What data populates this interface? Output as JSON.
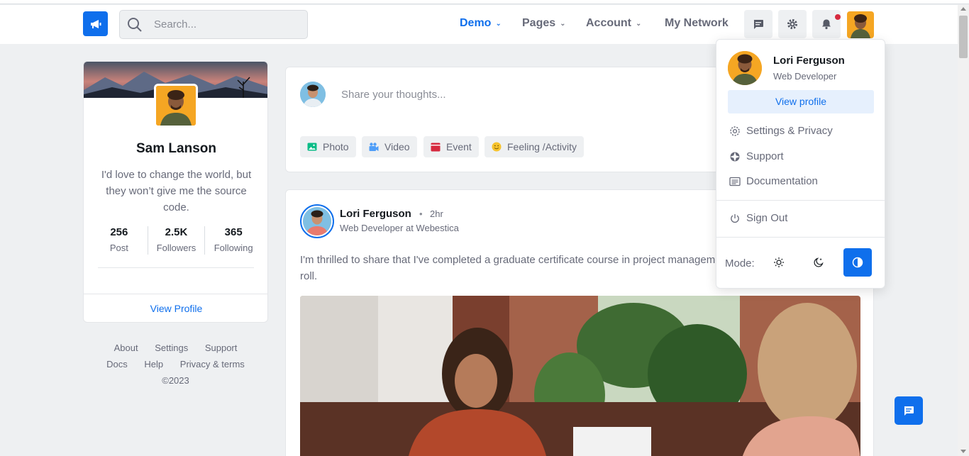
{
  "search": {
    "placeholder": "Search..."
  },
  "nav": {
    "links": [
      {
        "label": "Demo",
        "chevron": "⌄"
      },
      {
        "label": "Pages",
        "chevron": "⌄"
      },
      {
        "label": "Account",
        "chevron": "⌄"
      },
      {
        "label": "My Network"
      }
    ]
  },
  "profile": {
    "name": "Sam Lanson",
    "bio": "I'd love to change the world, but they won’t give me the source code.",
    "stats": [
      {
        "value": "256",
        "label": "Post"
      },
      {
        "value": "2.5K",
        "label": "Followers"
      },
      {
        "value": "365",
        "label": "Following"
      }
    ],
    "view_profile": "View Profile"
  },
  "side_links": {
    "row1": [
      "About",
      "Settings",
      "Support"
    ],
    "row2": [
      "Docs",
      "Help",
      "Privacy & terms"
    ],
    "copyright": "©2023"
  },
  "composer": {
    "placeholder": "Share your thoughts...",
    "actions": [
      {
        "label": "Photo",
        "icon": "image-icon",
        "color": "#0cbc87"
      },
      {
        "label": "Video",
        "icon": "video-icon",
        "color": "#4f9ef8"
      },
      {
        "label": "Event",
        "icon": "calendar-icon",
        "color": "#d6293e"
      },
      {
        "label": "Feeling /Activity",
        "icon": "smiley-icon",
        "color": "#f7c32e"
      }
    ]
  },
  "post": {
    "author": "Lori Ferguson",
    "dot": "•",
    "time": "2hr",
    "role": "Web Developer at Webestica",
    "text": "I'm thrilled to share that I've completed a graduate certificate course in project management with the president's honor roll."
  },
  "dropdown": {
    "name": "Lori Ferguson",
    "role": "Web Developer",
    "view_profile": "View profile",
    "items": [
      {
        "label": "Settings & Privacy",
        "icon": "gear-icon"
      },
      {
        "label": "Support",
        "icon": "lifebuoy-icon"
      },
      {
        "label": "Documentation",
        "icon": "document-icon"
      }
    ],
    "sign_out": "Sign Out",
    "mode_label": "Mode:",
    "modes": [
      "light",
      "dark",
      "auto"
    ],
    "active_mode": "auto"
  },
  "colors": {
    "primary": "#0f6fec",
    "danger": "#d6293e",
    "muted": "#676a79"
  }
}
